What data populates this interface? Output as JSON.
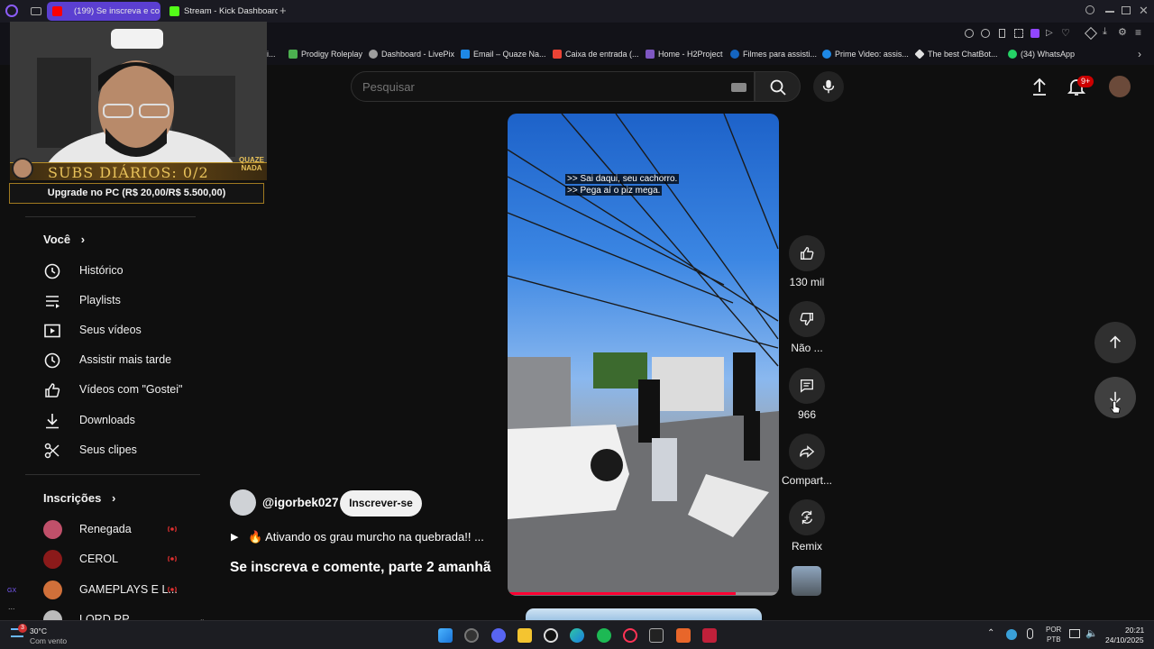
{
  "browser": {
    "tabs": [
      {
        "label": "(199) Se inscreva e co",
        "active": true
      },
      {
        "label": "Stream - Kick Dashboard",
        "active": false
      }
    ],
    "new_tab": "+"
  },
  "bookmarks": [
    {
      "label": "Prodigy Roleplay",
      "color": "#4caf50"
    },
    {
      "label": "Dashboard - LivePix",
      "color": "#9e9e9e"
    },
    {
      "label": "Email – Quaze Na...",
      "color": "#1e88e5"
    },
    {
      "label": "Caixa de entrada (...",
      "color": "#ea4335"
    },
    {
      "label": "Home - H2Project",
      "color": "#7e57c2"
    },
    {
      "label": "Filmes para assisti...",
      "color": "#1565c0"
    },
    {
      "label": "Prime Video: assis...",
      "color": "#1e88e5"
    },
    {
      "label": "The best ChatBot...",
      "color": "#e0e0e0"
    },
    {
      "label": "(34) WhatsApp",
      "color": "#25d366"
    }
  ],
  "bookmark_partial": "i...",
  "overlay": {
    "subs_text": "SUBS DIÁRIOS: 0/2",
    "brand": "QUAZE NADA",
    "upgrade": "Upgrade no PC (R$ 20,00/R$ 5.500,00)"
  },
  "search": {
    "placeholder": "Pesquisar"
  },
  "header": {
    "notifications": "9+"
  },
  "sidebar": {
    "you_label": "Você",
    "items": [
      {
        "label": "Histórico",
        "icon": "history-icon"
      },
      {
        "label": "Playlists",
        "icon": "playlists-icon"
      },
      {
        "label": "Seus vídeos",
        "icon": "your-videos-icon"
      },
      {
        "label": "Assistir mais tarde",
        "icon": "watch-later-icon"
      },
      {
        "label": "Vídeos com \"Gostei\"",
        "icon": "like-icon"
      },
      {
        "label": "Downloads",
        "icon": "download-icon"
      },
      {
        "label": "Seus clipes",
        "icon": "scissors-icon"
      }
    ],
    "subs_label": "Inscrições",
    "subscriptions": [
      {
        "name": "Renegada",
        "color": "#c0506a"
      },
      {
        "name": "CEROL",
        "color": "#8b1a1a"
      },
      {
        "name": "GAMEPLAYS E L...",
        "color": "#d0703a"
      },
      {
        "name": "LORD RP",
        "color": "#bbbbbb"
      }
    ]
  },
  "short": {
    "captions": [
      ">> Sai daqui, seu cachorro.",
      ">> Pega aí o piz mega."
    ],
    "channel": "@igorbek027",
    "subscribe": "Inscrever-se",
    "description": "🔥 Ativando os grau murcho na quebrada!! ...",
    "title": "Se inscreva e comente, parte 2 amanhã",
    "likes": "130 mil",
    "dislike": "Não ...",
    "comments": "966",
    "share": "Compart...",
    "remix": "Remix",
    "progress": 0.84
  },
  "taskbar": {
    "weather_temp": "30°C",
    "weather_desc": "Com vento",
    "weather_badge": "3",
    "lang1": "POR",
    "lang2": "PTB",
    "time": "20:21",
    "date": "24/10/2025"
  },
  "sidebar_marks": {
    "gx": "GX",
    "dots": "..."
  }
}
